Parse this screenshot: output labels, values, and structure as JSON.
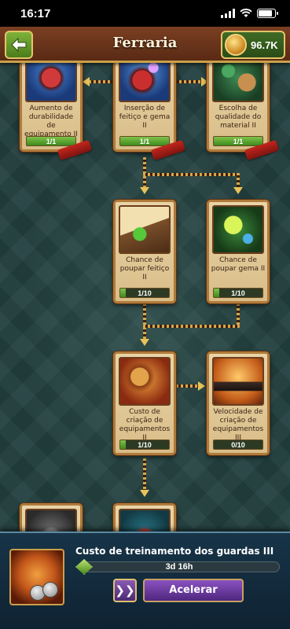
{
  "status_bar": {
    "time": "16:17"
  },
  "header": {
    "title": "Ferraria",
    "coins": "96.7K"
  },
  "tree": {
    "cards": [
      {
        "name": "Aumento de durabilidade de equipamento II",
        "progress": "1/1",
        "fill": 1.0
      },
      {
        "name": "Inserção de feitiço e gema II",
        "progress": "1/1",
        "fill": 1.0
      },
      {
        "name": "Escolha de qualidade do material II",
        "progress": "1/1",
        "fill": 1.0
      },
      {
        "name": "Chance de poupar feitiço II",
        "progress": "1/10",
        "fill": 0.1
      },
      {
        "name": "Chance de poupar gema II",
        "progress": "1/10",
        "fill": 0.1
      },
      {
        "name": "Custo de criação de equipamentos II",
        "progress": "1/10",
        "fill": 0.1
      },
      {
        "name": "Velocidade de criação de equipamentos III",
        "progress": "0/10",
        "fill": 0.0
      }
    ]
  },
  "panel": {
    "task_title": "Custo de treinamento dos guardas III",
    "timer": "3d 16h",
    "skip_label": "❯❯",
    "speed_label": "Acelerar"
  }
}
